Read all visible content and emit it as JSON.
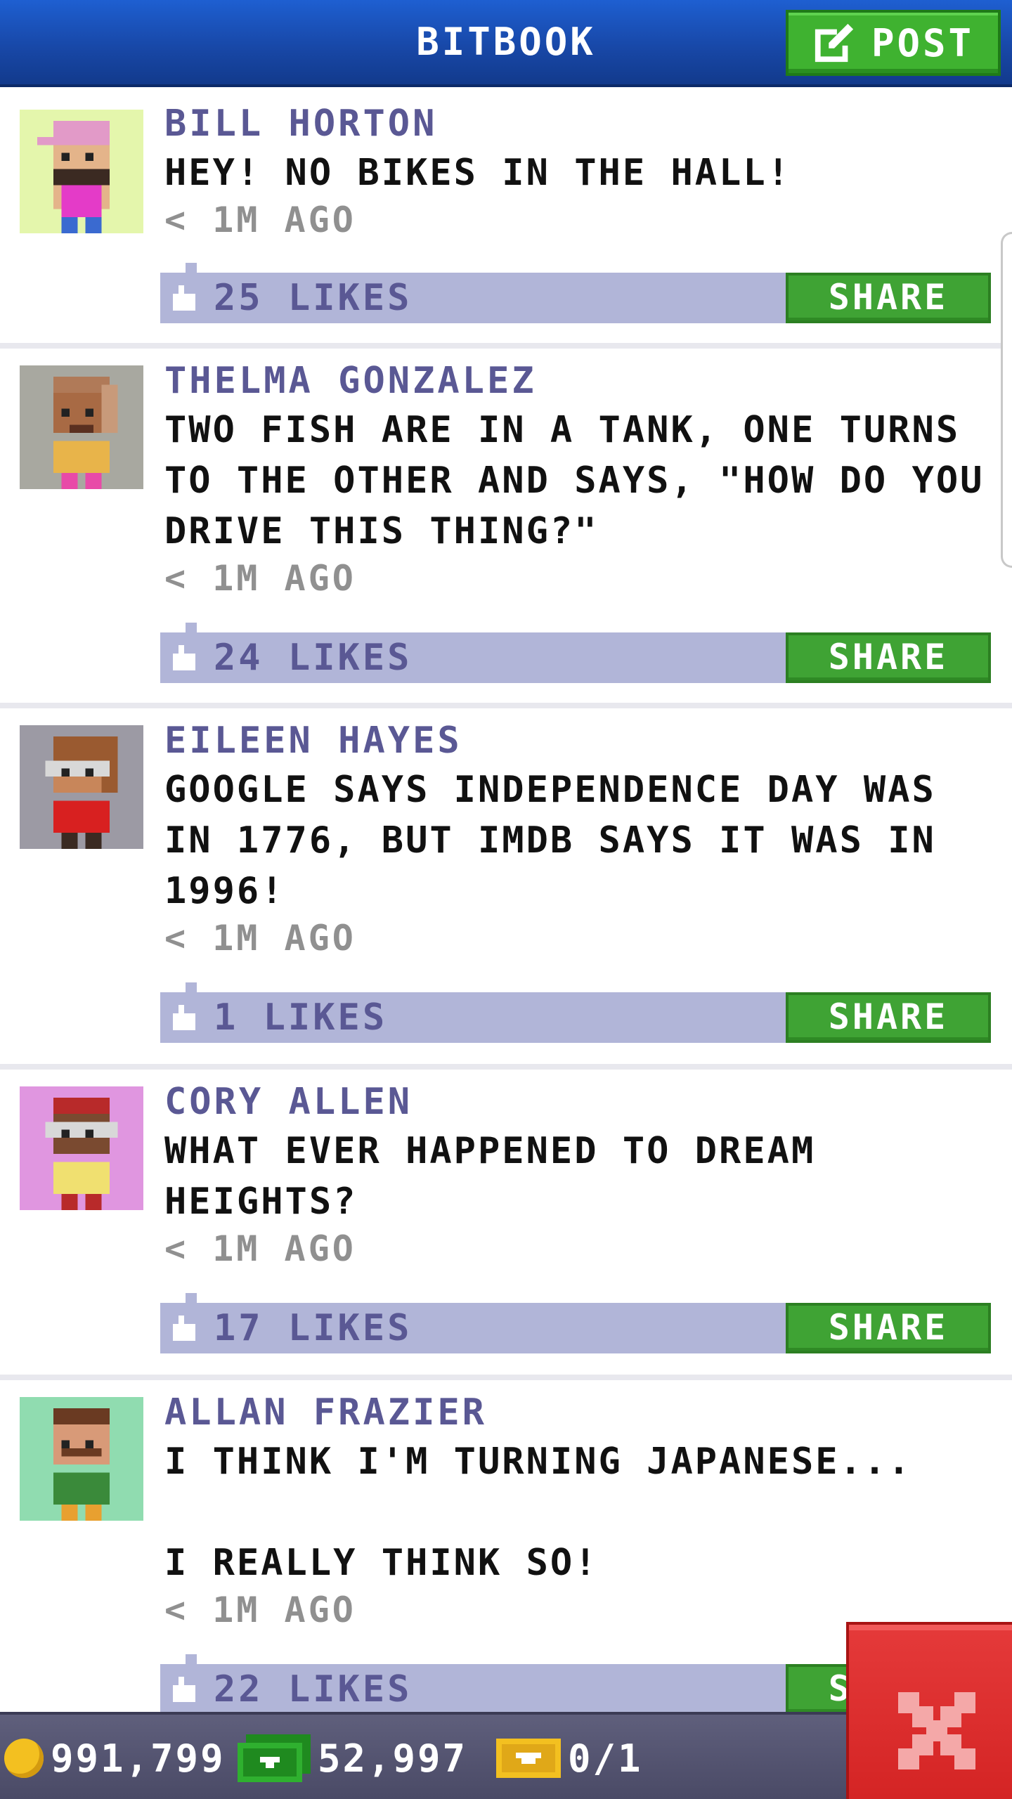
{
  "header": {
    "title": "BITBOOK",
    "post_label": "POST",
    "accent_color": "#1848a8",
    "post_color": "#3fb230"
  },
  "posts": [
    {
      "author": "BILL HORTON",
      "message": "HEY! NO BIKES IN THE HALL!",
      "time": "< 1M AGO",
      "likes": "25 LIKES",
      "share_label": "SHARE",
      "avatar_bg": "#e4f6ac"
    },
    {
      "author": "THELMA GONZALEZ",
      "message": "TWO FISH ARE IN A TANK, ONE TURNS TO THE OTHER AND SAYS, \"HOW DO YOU DRIVE THIS THING?\"",
      "time": "< 1M AGO",
      "likes": "24 LIKES",
      "share_label": "SHARE",
      "avatar_bg": "#a8a8a0"
    },
    {
      "author": "EILEEN HAYES",
      "message": "GOOGLE SAYS INDEPENDENCE DAY WAS IN 1776, BUT IMDB SAYS IT WAS IN 1996!",
      "time": "< 1M AGO",
      "likes": "1 LIKES",
      "share_label": "SHARE",
      "avatar_bg": "#9c9aa4"
    },
    {
      "author": "CORY ALLEN",
      "message": "WHAT EVER HAPPENED TO DREAM HEIGHTS?",
      "time": "< 1M AGO",
      "likes": "17 LIKES",
      "share_label": "SHARE",
      "avatar_bg": "#e096e0"
    },
    {
      "author": "ALLAN FRAZIER",
      "message": "I THINK I'M TURNING JAPANESE...\n\nI REALLY THINK SO!",
      "time": "< 1M AGO",
      "likes": "22 LIKES",
      "share_label": "SHARE",
      "avatar_bg": "#90dcb0"
    }
  ],
  "status_bar": {
    "coins": "991,799",
    "bux": "52,997",
    "tickets": "0/1"
  },
  "icons": {
    "post": "edit-icon",
    "like": "thumbs-up-icon",
    "coin": "coin-icon",
    "bux": "bux-icon",
    "ticket": "ticket-icon",
    "close": "close-icon"
  }
}
